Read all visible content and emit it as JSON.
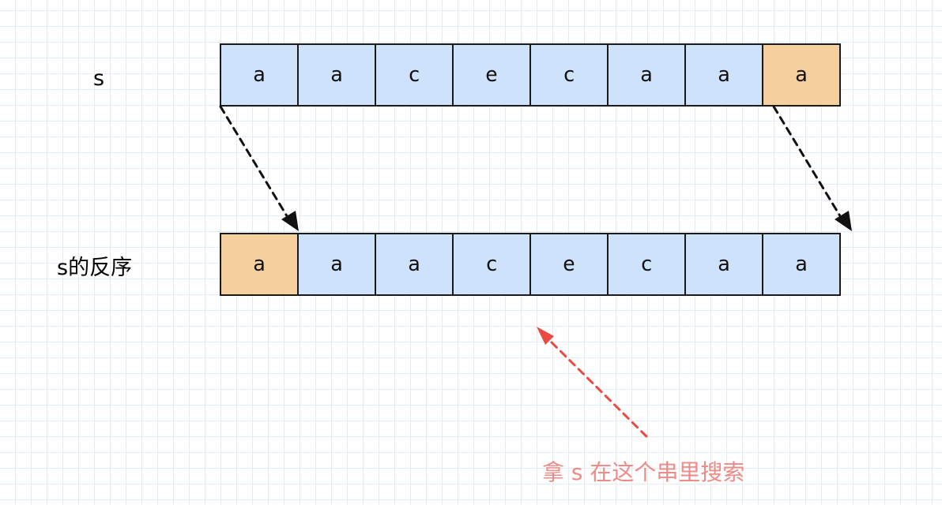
{
  "rows": [
    {
      "label": "s",
      "cells": [
        "a",
        "a",
        "c",
        "e",
        "c",
        "a",
        "a",
        "a"
      ],
      "highlight_index": 7
    },
    {
      "label": "s的反序",
      "cells": [
        "a",
        "a",
        "a",
        "c",
        "e",
        "c",
        "a",
        "a"
      ],
      "highlight_index": 0
    }
  ],
  "annotation": "拿 s 在这个串里搜索",
  "colors": {
    "cell": "#cfe2fb",
    "highlight": "#f6cf9f",
    "annotation": "#ef8a86",
    "annotation_arrow": "#e94b43",
    "arrow": "#111111"
  }
}
